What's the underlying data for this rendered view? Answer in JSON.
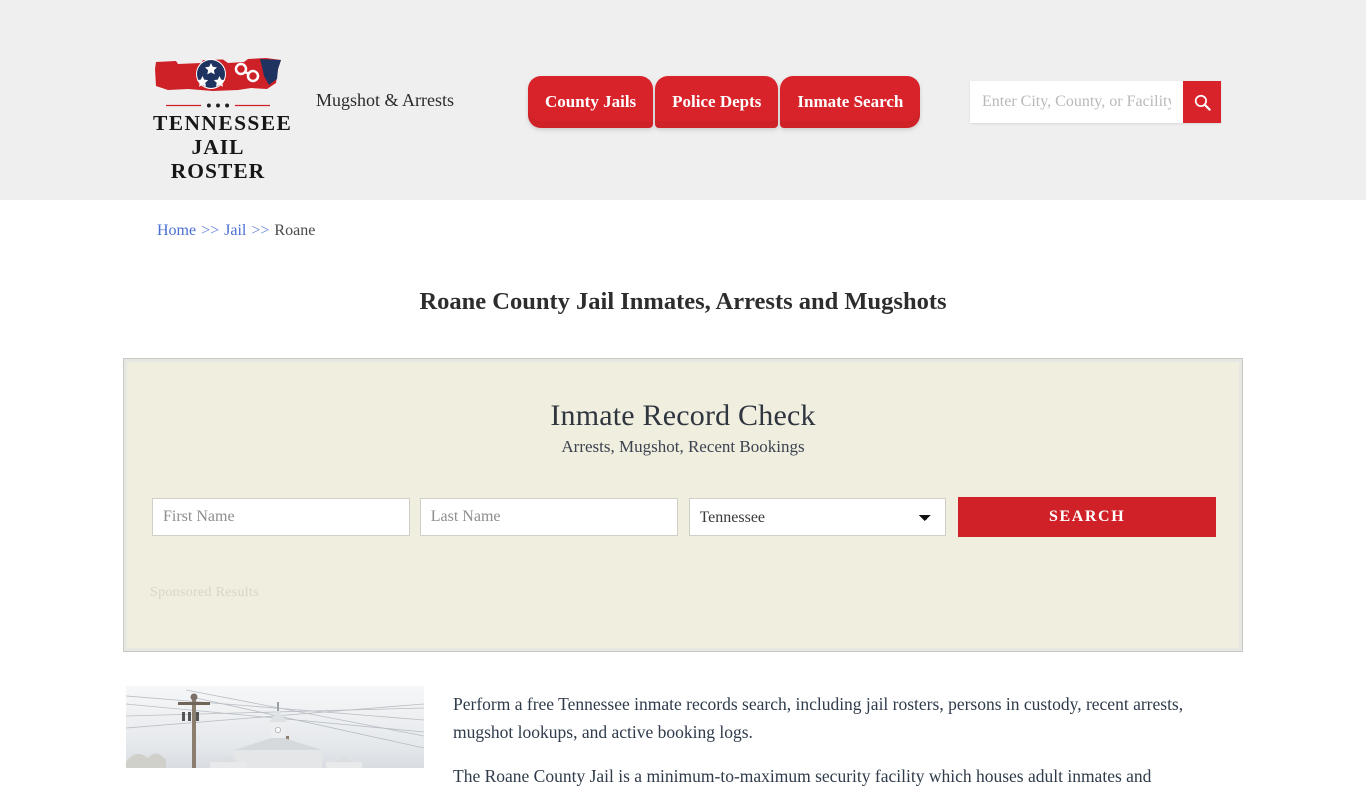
{
  "header": {
    "logo": {
      "line1": "TENNESSEE",
      "line2": "JAIL ROSTER",
      "icon": "tennessee-state-tristar-handcuffs"
    },
    "tagline": "Mugshot & Arrests",
    "nav": [
      {
        "label": "County Jails"
      },
      {
        "label": "Police Depts"
      },
      {
        "label": "Inmate Search"
      }
    ],
    "search": {
      "placeholder": "Enter City, County, or Facility Name",
      "value": "",
      "button_icon": "search-icon"
    },
    "colors": {
      "background": "#efefef",
      "accent_red": "#d8232a"
    }
  },
  "breadcrumb": {
    "items": [
      {
        "label": "Home",
        "link": true
      },
      {
        "label": "Jail",
        "link": true
      },
      {
        "label": "Roane",
        "link": false
      }
    ],
    "separator": ">>"
  },
  "page": {
    "title": "Roane County Jail Inmates, Arrests and Mugshots"
  },
  "record_check": {
    "title": "Inmate Record Check",
    "subtitle": "Arrests, Mugshot, Recent Bookings",
    "first_name": {
      "placeholder": "First Name",
      "value": ""
    },
    "last_name": {
      "placeholder": "Last Name",
      "value": ""
    },
    "state": {
      "selected": "Tennessee",
      "options": [
        "Tennessee"
      ]
    },
    "search_button": "SEARCH",
    "sponsored_label": "Sponsored Results",
    "colors": {
      "panel_background": "#f0eedf",
      "button_red": "#d02128"
    }
  },
  "content": {
    "image_alt": "roane-county-courthouse-photo",
    "paragraphs": [
      "Perform a free Tennessee inmate records search, including jail rosters, persons in custody, recent arrests, mugshot lookups, and active booking logs.",
      "The Roane County Jail is a minimum-to-maximum security facility which houses adult inmates and"
    ]
  }
}
